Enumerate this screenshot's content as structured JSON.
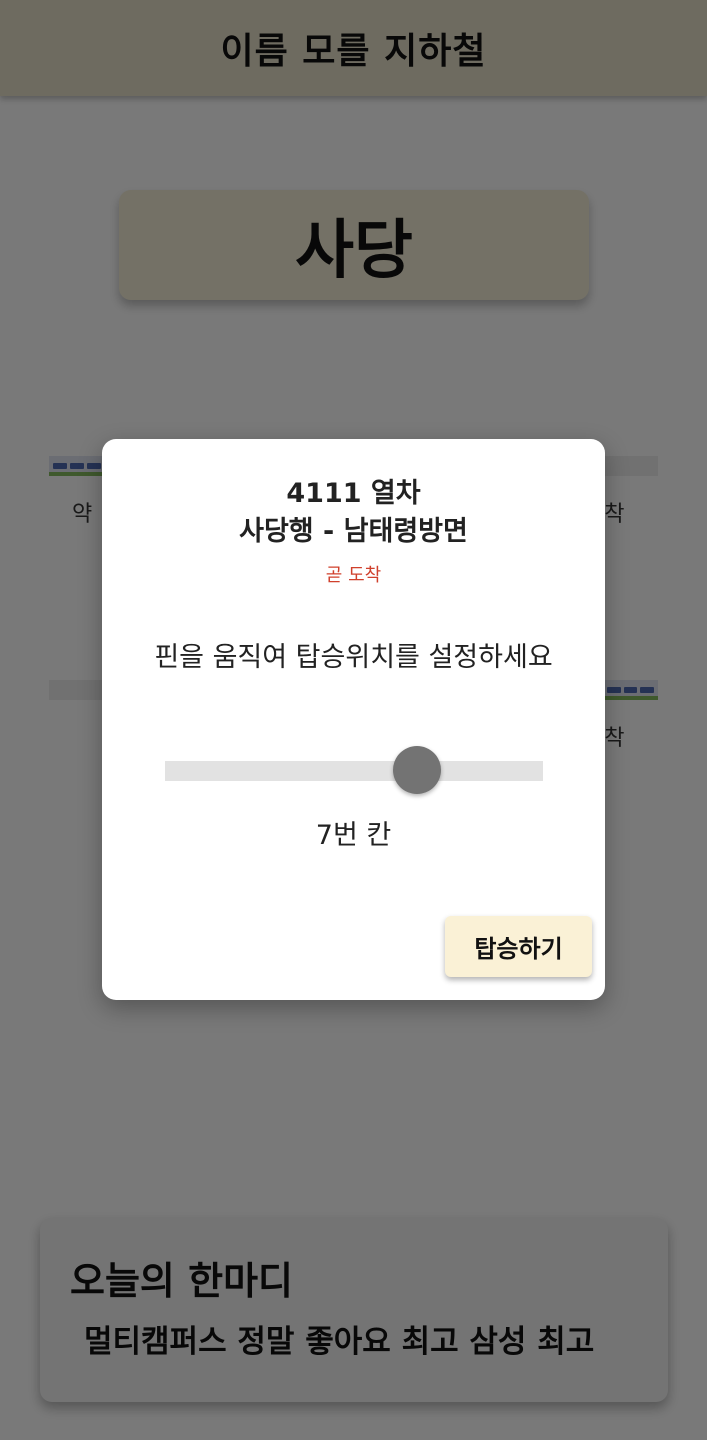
{
  "app": {
    "title": "이름 모를 지하철"
  },
  "station": {
    "name": "사당"
  },
  "tracks": {
    "top_left_label": "약",
    "top_right_label": "도착",
    "bottom_right_label": "도착"
  },
  "modal": {
    "train_number": "4111 열차",
    "direction": "사당행 - 남태령방면",
    "status": "곧 도착",
    "status_color": "#d0402c",
    "instruction": "핀을 움직여 탑승위치를 설정하세요",
    "slider": {
      "value": 7,
      "min": 1,
      "max": 10,
      "value_label": "7번 칸"
    },
    "board_button": "탑승하기"
  },
  "quote": {
    "heading": "오늘의 한마디",
    "text": "멀티캠퍼스 정말 좋아요 최고 삼성 최고"
  },
  "colors": {
    "header_bg": "#ddd7c0",
    "station_card_bg": "#e9e3cc",
    "button_bg": "#faf1d6",
    "slider_thumb": "#737373"
  }
}
